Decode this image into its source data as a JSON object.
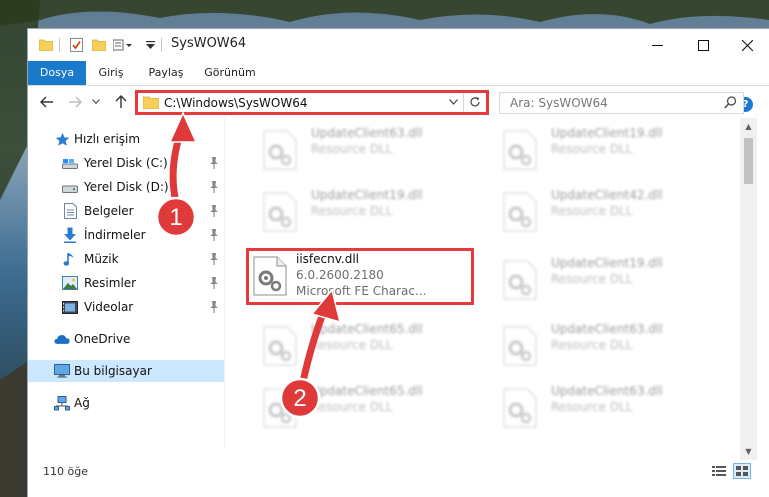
{
  "window": {
    "title": "SysWOW64"
  },
  "ribbon": {
    "tabs": [
      {
        "label": "Dosya",
        "active": true
      },
      {
        "label": "Giriş",
        "active": false
      },
      {
        "label": "Paylaş",
        "active": false
      },
      {
        "label": "Görünüm",
        "active": false
      }
    ],
    "help_label": "?"
  },
  "address": {
    "path": "C:\\Windows\\SysWOW64"
  },
  "search": {
    "placeholder": "Ara: SysWOW64"
  },
  "sidebar": {
    "items": [
      {
        "label": "Hızlı erişim",
        "icon": "star-icon",
        "pinned": false
      },
      {
        "label": "Yerel Disk (C:)",
        "icon": "drive-icon",
        "pinned": true
      },
      {
        "label": "Yerel Disk (D:)",
        "icon": "drive-icon",
        "pinned": true
      },
      {
        "label": "Belgeler",
        "icon": "document-icon",
        "pinned": true
      },
      {
        "label": "İndirmeler",
        "icon": "download-icon",
        "pinned": true
      },
      {
        "label": "Müzik",
        "icon": "music-icon",
        "pinned": true
      },
      {
        "label": "Resimler",
        "icon": "pictures-icon",
        "pinned": true
      },
      {
        "label": "Videolar",
        "icon": "video-icon",
        "pinned": true
      },
      {
        "label": "OneDrive",
        "icon": "cloud-icon",
        "pinned": false
      },
      {
        "label": "Bu bilgisayar",
        "icon": "computer-icon",
        "pinned": false,
        "selected": true
      },
      {
        "label": "Ağ",
        "icon": "network-icon",
        "pinned": false
      }
    ]
  },
  "files": {
    "left_column": [
      {
        "name": "UpdateClient63.dll",
        "type": "Resource DLL",
        "blurred": true
      },
      {
        "name": "UpdateClient19.dll",
        "type": "Resource DLL",
        "blurred": true
      },
      {
        "name": "iisfecnv.dll",
        "version": "6.0.2600.2180",
        "description": "Microsoft FE Charac...",
        "highlighted": true
      },
      {
        "name": "UpdateClient65.dll",
        "type": "Resource DLL",
        "blurred": true
      },
      {
        "name": "UpdateClient65.dll",
        "type": "Resource DLL",
        "blurred": true
      }
    ],
    "right_column": [
      {
        "name": "UpdateClient19.dll",
        "type": "Resource DLL",
        "blurred": true
      },
      {
        "name": "UpdateClient42.dll",
        "type": "Resource DLL",
        "blurred": true
      },
      {
        "name": "UpdateClient19.dll",
        "type": "Resource DLL",
        "blurred": true
      },
      {
        "name": "UpdateClient63.dll",
        "type": "Resource DLL",
        "blurred": true
      },
      {
        "name": "UpdateClient63.dll",
        "type": "Resource DLL",
        "blurred": true
      }
    ]
  },
  "status": {
    "item_count": "110 öğe"
  },
  "callouts": [
    {
      "number": "1"
    },
    {
      "number": "2"
    }
  ],
  "colors": {
    "accent": "#1979ca",
    "highlight_border": "#e53b3b",
    "callout_fill": "#e0393a",
    "selected_bg": "#cce8ff"
  }
}
